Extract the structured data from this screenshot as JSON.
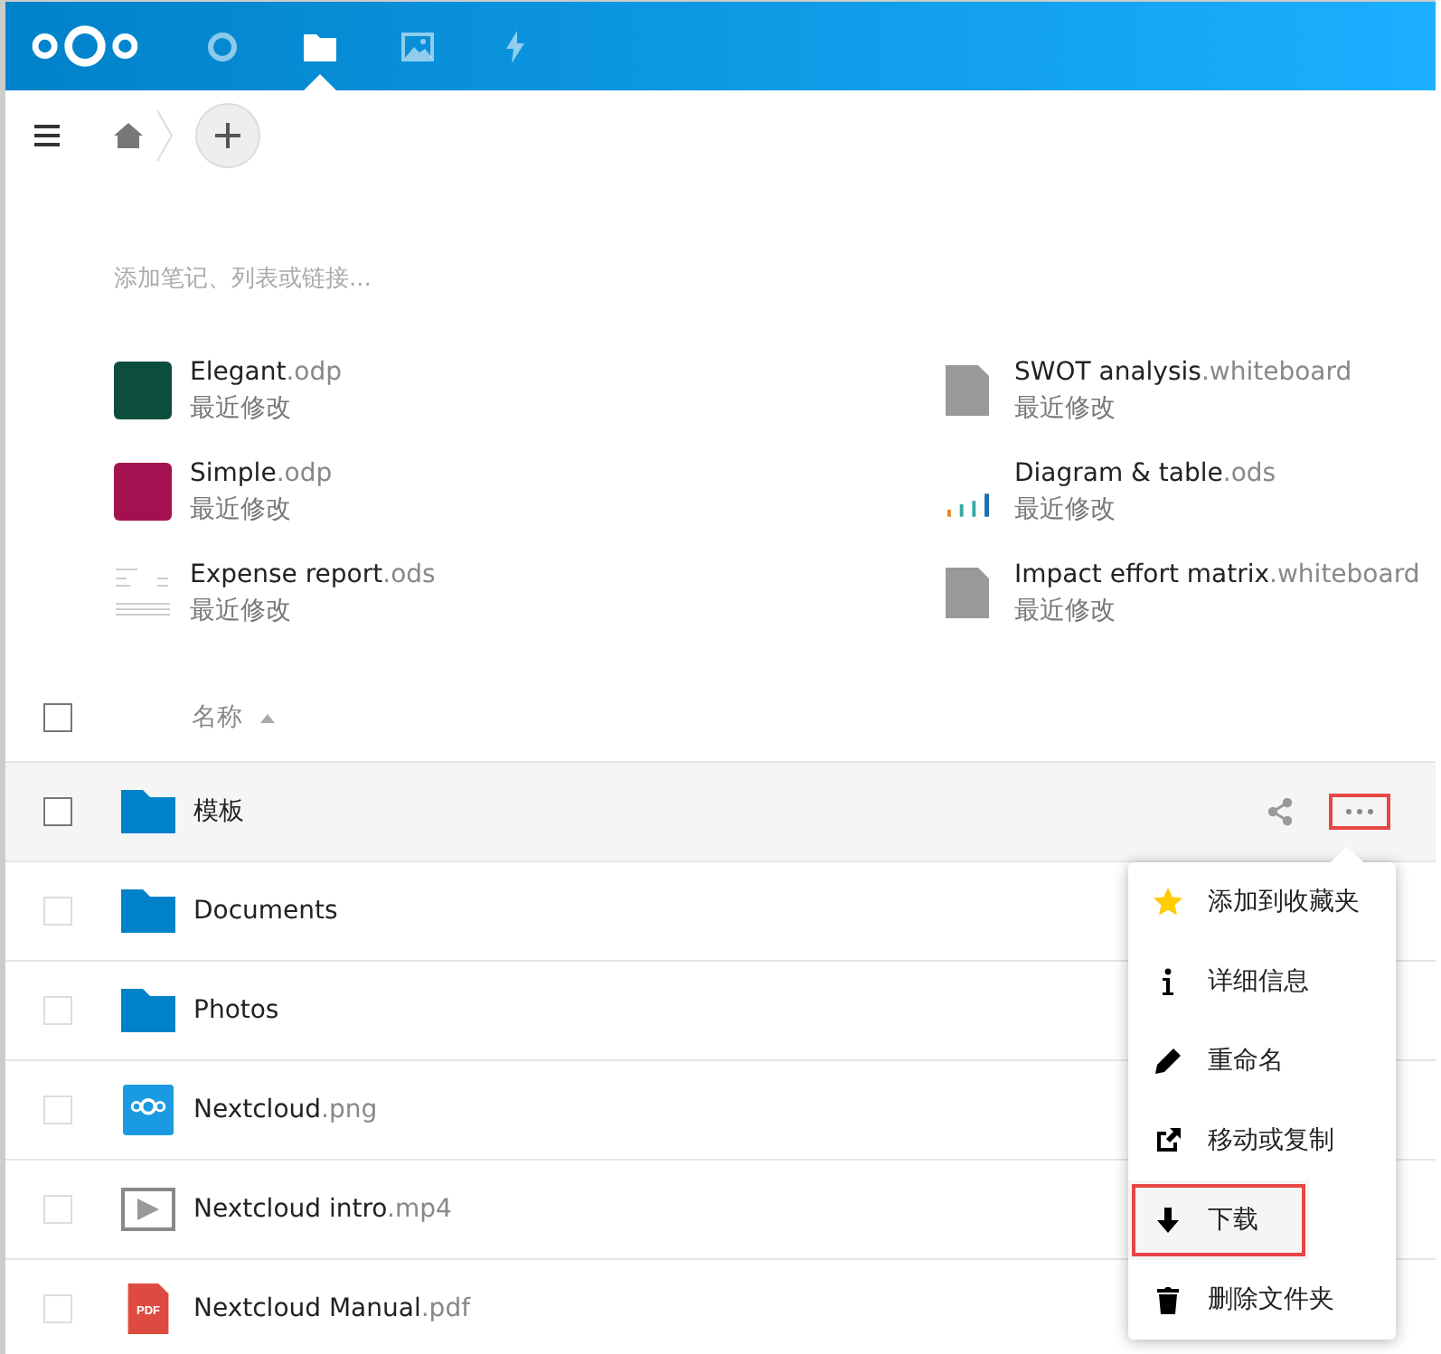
{
  "header": {
    "tabs": [
      {
        "kind": "dashboard",
        "selected": false
      },
      {
        "kind": "files",
        "selected": true
      },
      {
        "kind": "photos",
        "selected": false
      },
      {
        "kind": "activity",
        "selected": false
      }
    ]
  },
  "note": {
    "placeholder": "添加笔记、列表或链接..."
  },
  "recent": [
    {
      "name": "Elegant",
      "ext": ".odp",
      "subtitle": "最近修改",
      "kind": "slides-green"
    },
    {
      "name": "SWOT analysis",
      "ext": ".whiteboard",
      "subtitle": "最近修改",
      "kind": "whiteboard"
    },
    {
      "name": "Simple",
      "ext": ".odp",
      "subtitle": "最近修改",
      "kind": "slides-red"
    },
    {
      "name": "Diagram & table",
      "ext": ".ods",
      "subtitle": "最近修改",
      "kind": "chart"
    },
    {
      "name": "Expense report",
      "ext": ".ods",
      "subtitle": "最近修改",
      "kind": "sheet"
    },
    {
      "name": "Impact effort matrix",
      "ext": ".whiteboard",
      "subtitle": "最近修改",
      "kind": "whiteboard"
    }
  ],
  "table": {
    "select_all": {
      "checked": false
    },
    "column": "名称",
    "rows": [
      {
        "name": "模板",
        "ext": "",
        "kind": "folder",
        "highlighted": true
      },
      {
        "name": "Documents",
        "ext": "",
        "kind": "folder",
        "highlighted": false
      },
      {
        "name": "Photos",
        "ext": "",
        "kind": "folder",
        "highlighted": false
      },
      {
        "name": "Nextcloud",
        "ext": ".png",
        "kind": "image",
        "highlighted": false
      },
      {
        "name": "Nextcloud intro",
        "ext": ".mp4",
        "kind": "video",
        "highlighted": false
      },
      {
        "name": "Nextcloud Manual",
        "ext": ".pdf",
        "kind": "pdf",
        "badge": "PDF",
        "highlighted": false
      }
    ]
  },
  "menu": {
    "items": [
      {
        "label": "添加到收藏夹",
        "kind": "star",
        "highlighted": false
      },
      {
        "label": "详细信息",
        "kind": "info",
        "highlighted": false
      },
      {
        "label": "重命名",
        "kind": "rename",
        "highlighted": false
      },
      {
        "label": "移动或复制",
        "kind": "move",
        "highlighted": false
      },
      {
        "label": "下载",
        "kind": "download",
        "highlighted": true
      },
      {
        "label": "删除文件夹",
        "kind": "delete",
        "highlighted": false
      }
    ]
  }
}
